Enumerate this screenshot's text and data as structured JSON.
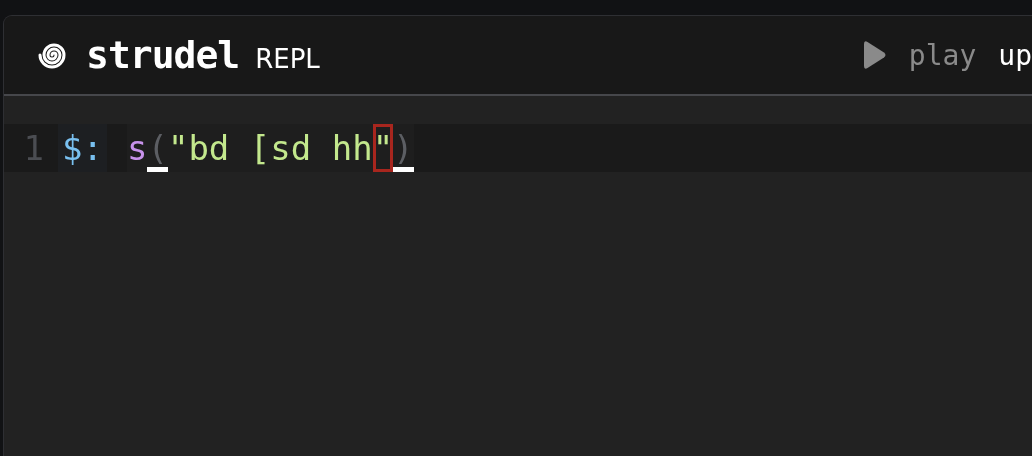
{
  "header": {
    "title": "strudel",
    "subtitle": "REPL",
    "buttons": [
      {
        "label": "play",
        "kind": "play"
      },
      {
        "label": "up",
        "kind": "text"
      }
    ]
  },
  "editor": {
    "lines": [
      {
        "number": "1",
        "active": true,
        "label": "$:",
        "tokens": [
          {
            "text": "s",
            "kind": "function",
            "matched": false,
            "highlighted": false
          },
          {
            "text": "(",
            "kind": "punct",
            "matched": true,
            "highlighted": false
          },
          {
            "text": "\"bd [sd hh",
            "kind": "string",
            "matched": false,
            "highlighted": false
          },
          {
            "text": "\"",
            "kind": "string",
            "matched": false,
            "highlighted": true
          },
          {
            "text": ")",
            "kind": "punct",
            "matched": true,
            "highlighted": false
          }
        ]
      }
    ]
  }
}
